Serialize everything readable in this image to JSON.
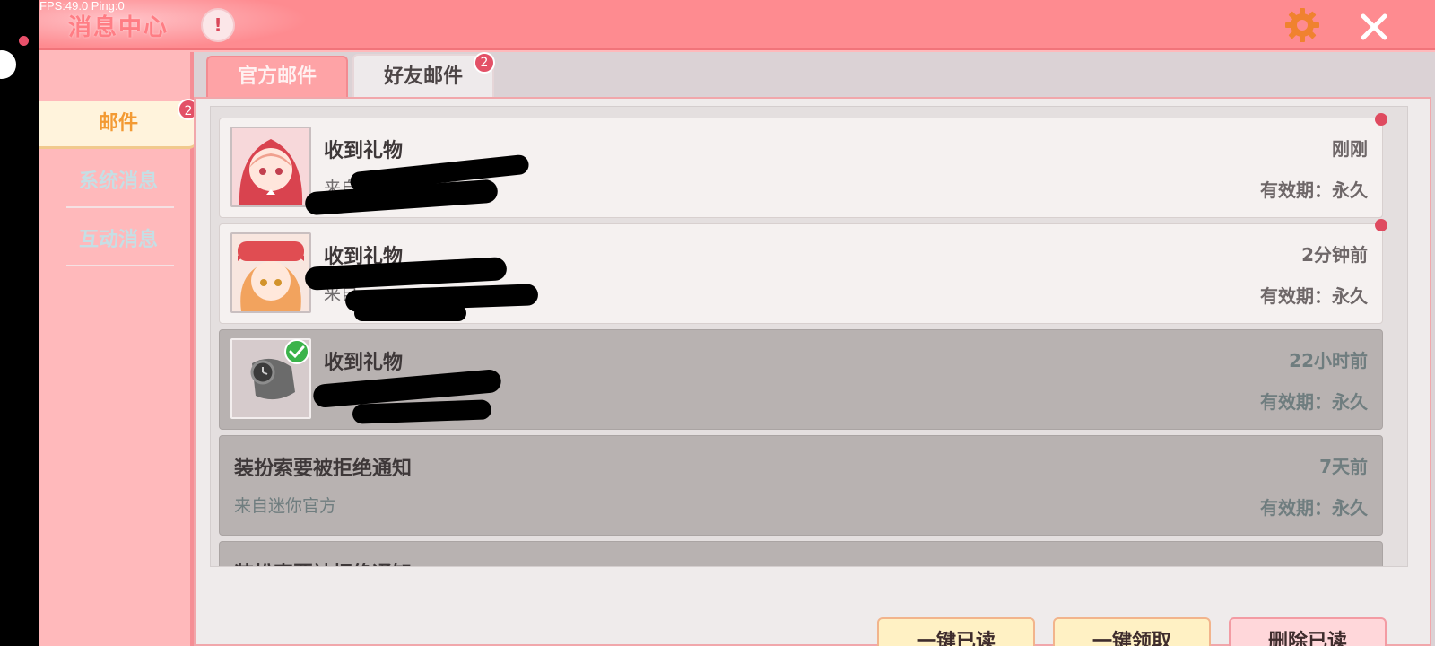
{
  "overlay": {
    "fps_text": "FPS:49.0  Ping:0"
  },
  "header": {
    "title": "消息中心",
    "info_icon": "exclamation-icon",
    "settings_icon": "gear-icon",
    "close_icon": "close-icon"
  },
  "sidebar": {
    "items": [
      {
        "label": "邮件",
        "active": true,
        "badge": "2"
      },
      {
        "label": "系统消息",
        "active": false
      },
      {
        "label": "互动消息",
        "active": false
      }
    ]
  },
  "tabs": [
    {
      "label": "官方邮件",
      "active": false
    },
    {
      "label": "好友邮件",
      "active": true,
      "badge": "2"
    }
  ],
  "mails": [
    {
      "title": "收到礼物",
      "sender": "来自",
      "time": "刚刚",
      "expiry": "有效期：永久",
      "unread": true,
      "avatar": "girl-red-hood-avatar"
    },
    {
      "title": "收到礼物",
      "sender": "来自",
      "time": "2分钟前",
      "expiry": "有效期：永久",
      "unread": true,
      "avatar": "girl-orange-hair-avatar"
    },
    {
      "title": "收到礼物",
      "sender": "",
      "time": "22小时前",
      "expiry": "有效期：永久",
      "unread": false,
      "avatar": "watch-gift-icon"
    },
    {
      "title": "装扮索要被拒绝通知",
      "sender": "来自迷你官方",
      "time": "7天前",
      "expiry": "有效期：永久",
      "unread": false
    },
    {
      "title": "装扮索要被拒绝通知",
      "sender": "",
      "time": "",
      "expiry": "",
      "unread": false
    }
  ],
  "actions": {
    "read_all": "一键已读",
    "claim_all": "一键领取",
    "delete_read": "删除已读"
  },
  "colors": {
    "topbar": "#fe8b90",
    "sidebar": "#ffb9bb",
    "badge": "#e35167",
    "accent_orange": "#f39a33"
  }
}
